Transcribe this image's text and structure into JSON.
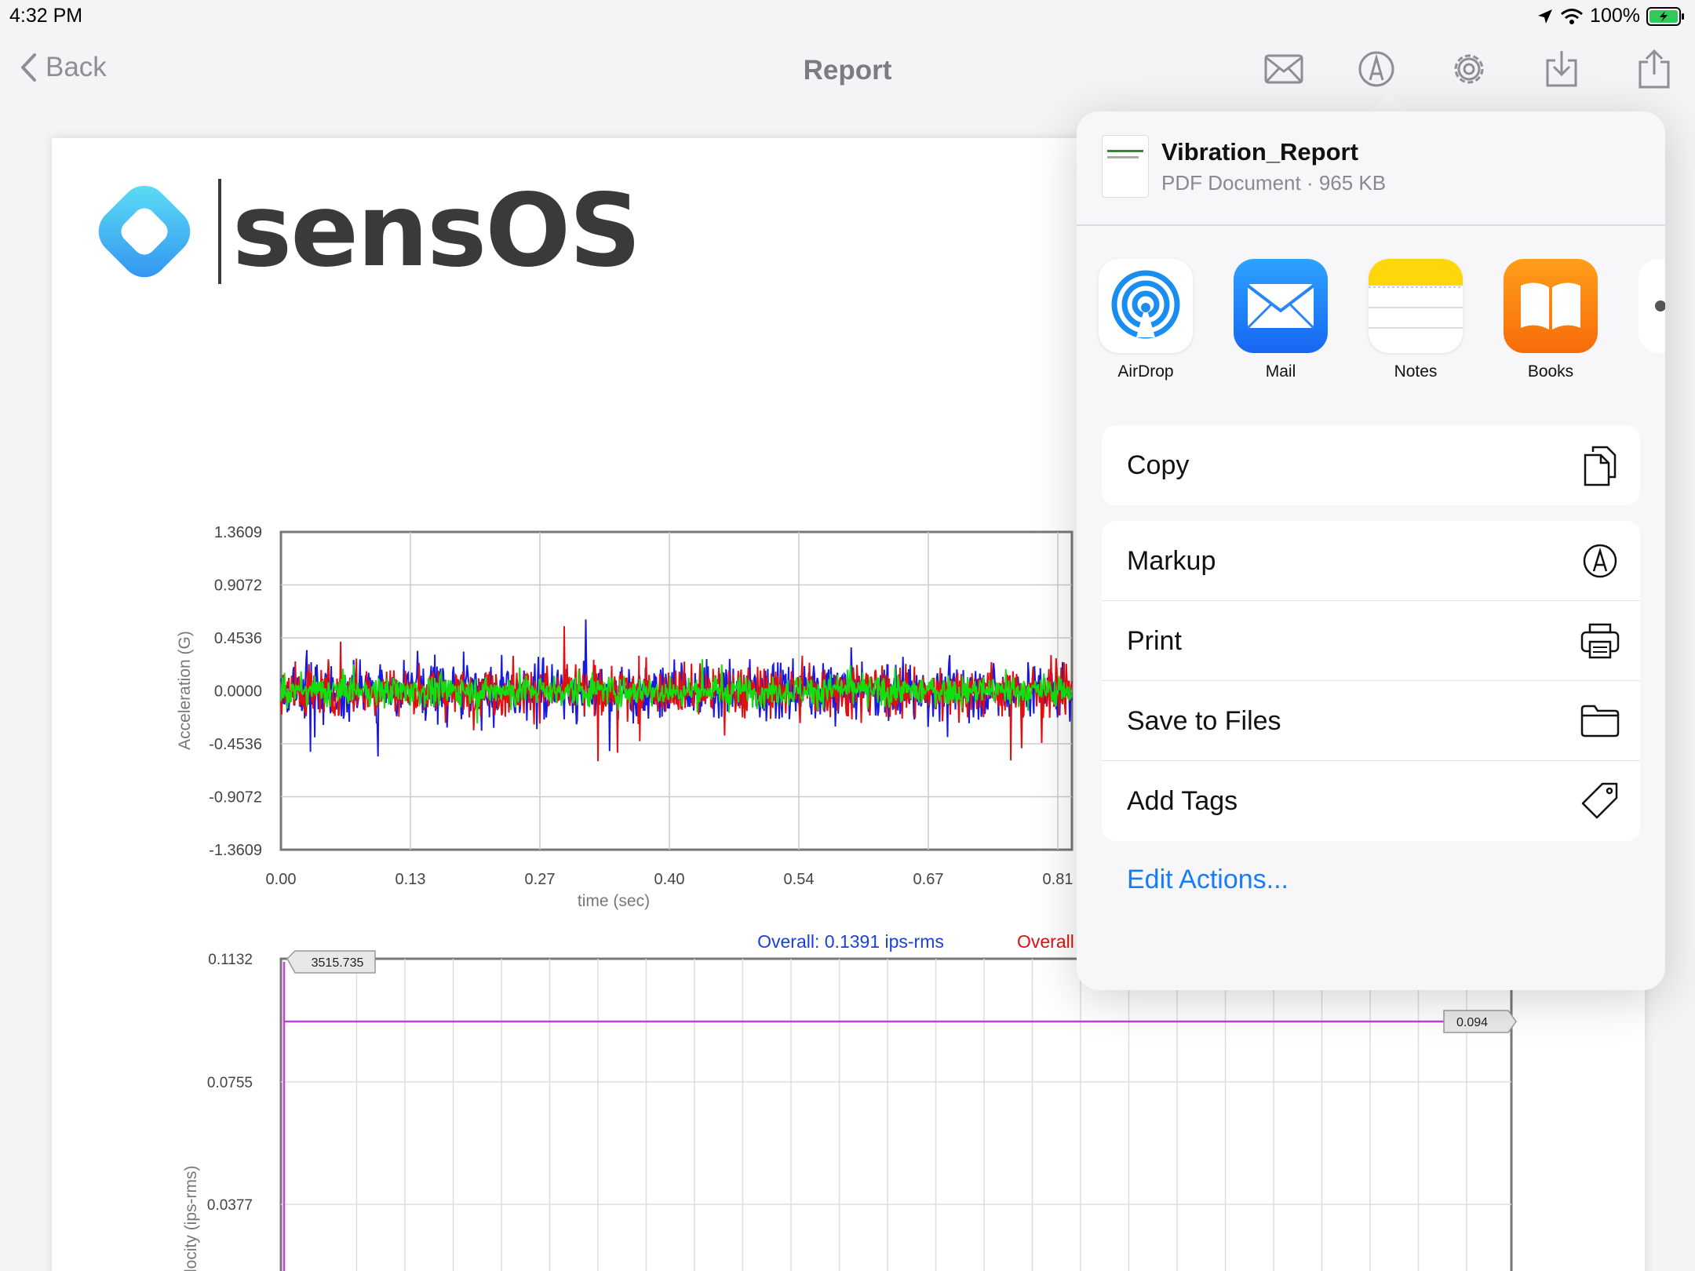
{
  "status_bar": {
    "time": "4:32 PM",
    "battery": "100%"
  },
  "nav": {
    "back_label": "Back",
    "title": "Report",
    "icons": [
      "mail-icon",
      "markup-icon",
      "gear-icon",
      "download-icon",
      "share-icon"
    ]
  },
  "document": {
    "logo_text": "sensOS",
    "accel_chart": {
      "type": "line",
      "ylabel": "Acceleration (G)",
      "xlabel": "time (sec)",
      "yticks": [
        "1.3609",
        "0.9072",
        "0.4536",
        "0.0000",
        "-0.4536",
        "-0.9072",
        "-1.3609"
      ],
      "xticks": [
        "0.00",
        "0.13",
        "0.27",
        "0.40",
        "0.54",
        "0.67",
        "0.81"
      ],
      "ylim": [
        -1.3609,
        1.3609
      ],
      "series_colors": [
        "#1a1adf",
        "#e01010",
        "#10e010"
      ]
    },
    "velocity_chart": {
      "type": "line",
      "ylabel": "Velocity (ips-rms)",
      "yticks": [
        "0.1132",
        "0.0755",
        "0.0377"
      ],
      "overall_blue": "Overall: 0.1391 ips-rms",
      "overall_red": "Overall",
      "marker_x_label": "3515.735",
      "marker_y_label": "0.094"
    }
  },
  "share_sheet": {
    "file_name": "Vibration_Report",
    "file_meta": "PDF Document · 965 KB",
    "apps": [
      {
        "label": "AirDrop",
        "icon": "airdrop-icon"
      },
      {
        "label": "Mail",
        "icon": "mail-app-icon"
      },
      {
        "label": "Notes",
        "icon": "notes-app-icon"
      },
      {
        "label": "Books",
        "icon": "books-app-icon"
      }
    ],
    "actions_group1": [
      {
        "label": "Copy",
        "icon": "copy-icon"
      }
    ],
    "actions_group2": [
      {
        "label": "Markup",
        "icon": "markup-icon"
      },
      {
        "label": "Print",
        "icon": "printer-icon"
      },
      {
        "label": "Save to Files",
        "icon": "folder-icon"
      },
      {
        "label": "Add Tags",
        "icon": "tag-icon"
      }
    ],
    "edit_actions": "Edit Actions..."
  }
}
